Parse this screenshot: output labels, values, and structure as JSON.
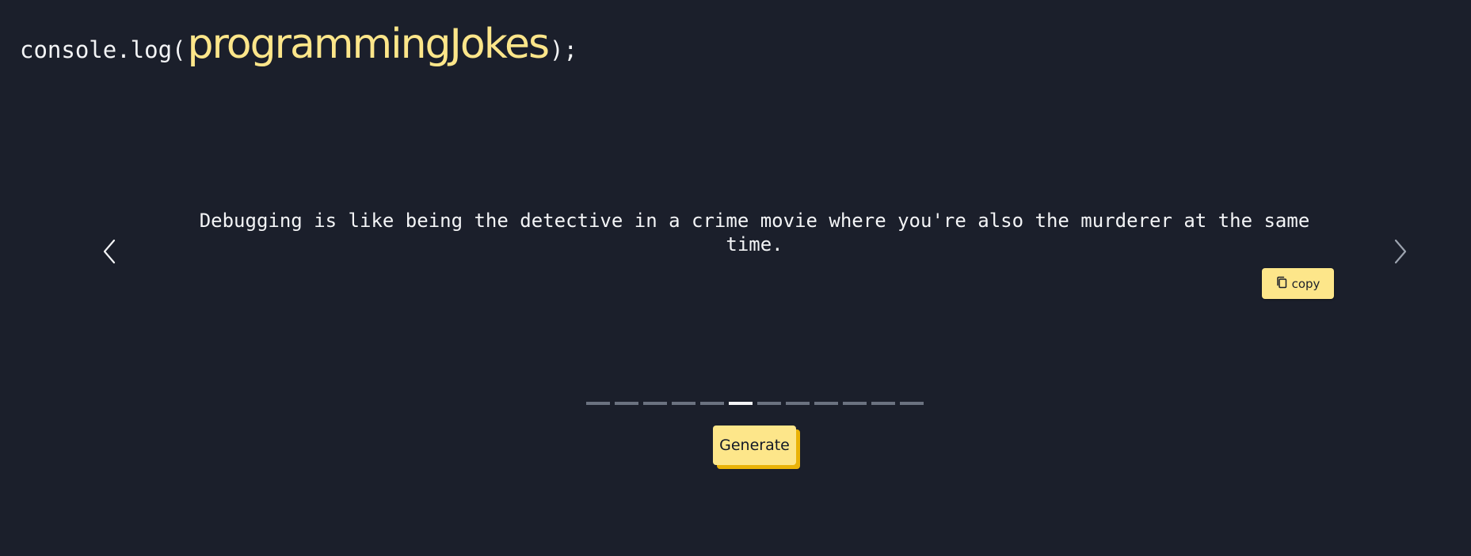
{
  "header": {
    "prefix": "console.log(",
    "highlight": "programmingJokes",
    "suffix": ");"
  },
  "joke": {
    "text": "Debugging is like being the detective in a crime movie where you're also the murderer at the same time."
  },
  "actions": {
    "copy_label": "copy",
    "generate_label": "Generate"
  },
  "pagination": {
    "total": 12,
    "active_index": 5
  },
  "icons": {
    "prev": "chevron-left-icon",
    "next": "chevron-right-icon",
    "copy": "copy-icon"
  },
  "colors": {
    "background": "#1b1f2b",
    "accent": "#fde68a",
    "accent_shadow": "#eab308",
    "text": "#f3f4f6",
    "indicator_inactive": "#6b7280"
  }
}
